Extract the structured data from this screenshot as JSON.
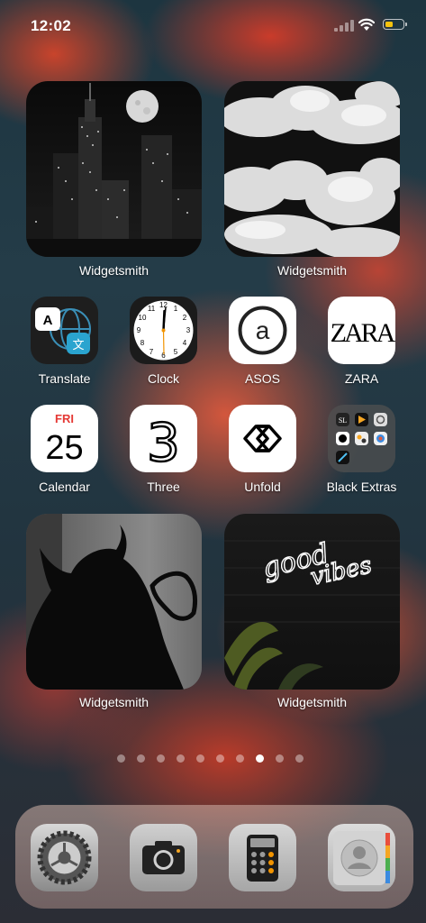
{
  "status_bar": {
    "time": "12:02",
    "battery_color": "#f4c20d"
  },
  "widgets": [
    {
      "label": "Widgetsmith",
      "image": "new-york-skyline-night-photo"
    },
    {
      "label": "Widgetsmith",
      "image": "black-and-white-clouds-photo"
    },
    {
      "label": "Widgetsmith",
      "image": "horned-silhouette-photo"
    },
    {
      "label": "Widgetsmith",
      "image": "good-vibes-neon-sign-photo",
      "neon_text_line1": "good",
      "neon_text_line2": "vibes"
    }
  ],
  "apps": [
    {
      "label": "Translate",
      "icon": "translate-icon",
      "glyph_a": "A",
      "glyph_b": "文"
    },
    {
      "label": "Clock",
      "icon": "clock-icon"
    },
    {
      "label": "ASOS",
      "icon": "asos-icon",
      "glyph": "a"
    },
    {
      "label": "ZARA",
      "icon": "zara-icon",
      "logo_text": "ZARA"
    },
    {
      "label": "Calendar",
      "icon": "calendar-icon",
      "weekday": "FRI",
      "day": "25"
    },
    {
      "label": "Three",
      "icon": "three-icon",
      "glyph": "3"
    },
    {
      "label": "Unfold",
      "icon": "unfold-icon"
    },
    {
      "label": "Black Extras",
      "icon": "folder-icon",
      "folder_glyph": "SL"
    }
  ],
  "page_dots": {
    "count": 10,
    "active_index": 7
  },
  "dock": [
    {
      "icon": "settings-icon"
    },
    {
      "icon": "camera-icon"
    },
    {
      "icon": "calculator-icon"
    },
    {
      "icon": "contacts-icon"
    }
  ]
}
